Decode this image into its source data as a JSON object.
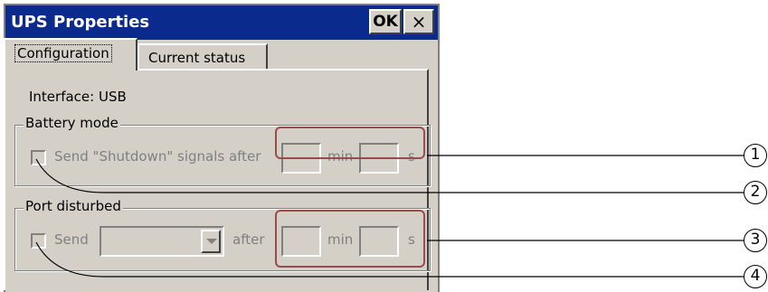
{
  "window": {
    "title": "UPS Properties",
    "ok_label": "OK",
    "close_label": "×"
  },
  "tabs": [
    {
      "label": "Configuration",
      "selected": true
    },
    {
      "label": "Current status",
      "selected": false
    }
  ],
  "interface_text": "Interface: USB",
  "battery_mode": {
    "legend": "Battery mode",
    "checkbox_label": "Send \"Shutdown\" signals after",
    "minutes_value": "",
    "min_unit": "min",
    "seconds_value": "",
    "s_unit": "s",
    "enabled": false
  },
  "port_disturbed": {
    "legend": "Port disturbed",
    "send_label": "Send",
    "signal_select_value": "",
    "after_label": "after",
    "minutes_value": "",
    "min_unit": "min",
    "seconds_value": "",
    "s_unit": "s",
    "enabled": false
  },
  "callouts": [
    "1",
    "2",
    "3",
    "4"
  ],
  "colors": {
    "title_bar": "#0b2a8e",
    "dialog_bg": "#d4d0c8",
    "highlight": "#9a4b4b",
    "disabled_text": "#808080"
  }
}
